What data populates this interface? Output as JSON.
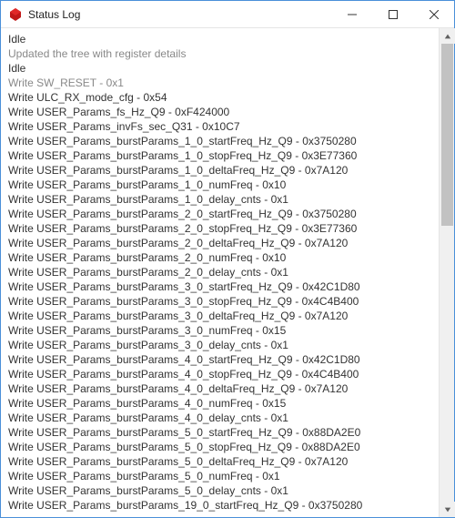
{
  "window": {
    "title": "Status Log"
  },
  "log": {
    "lines": [
      {
        "text": "Idle",
        "grey": false
      },
      {
        "text": "Updated the tree with register details",
        "grey": true
      },
      {
        "text": "Idle",
        "grey": false
      },
      {
        "text": "Write SW_RESET - 0x1",
        "grey": true
      },
      {
        "text": "Write ULC_RX_mode_cfg - 0x54",
        "grey": false
      },
      {
        "text": "Write USER_Params_fs_Hz_Q9 - 0xF424000",
        "grey": false
      },
      {
        "text": "Write USER_Params_invFs_sec_Q31 - 0x10C7",
        "grey": false
      },
      {
        "text": "Write USER_Params_burstParams_1_0_startFreq_Hz_Q9 - 0x3750280",
        "grey": false
      },
      {
        "text": "Write USER_Params_burstParams_1_0_stopFreq_Hz_Q9 - 0x3E77360",
        "grey": false
      },
      {
        "text": "Write USER_Params_burstParams_1_0_deltaFreq_Hz_Q9 - 0x7A120",
        "grey": false
      },
      {
        "text": "Write USER_Params_burstParams_1_0_numFreq - 0x10",
        "grey": false
      },
      {
        "text": "Write USER_Params_burstParams_1_0_delay_cnts - 0x1",
        "grey": false
      },
      {
        "text": "Write USER_Params_burstParams_2_0_startFreq_Hz_Q9 - 0x3750280",
        "grey": false
      },
      {
        "text": "Write USER_Params_burstParams_2_0_stopFreq_Hz_Q9 - 0x3E77360",
        "grey": false
      },
      {
        "text": "Write USER_Params_burstParams_2_0_deltaFreq_Hz_Q9 - 0x7A120",
        "grey": false
      },
      {
        "text": "Write USER_Params_burstParams_2_0_numFreq - 0x10",
        "grey": false
      },
      {
        "text": "Write USER_Params_burstParams_2_0_delay_cnts - 0x1",
        "grey": false
      },
      {
        "text": "Write USER_Params_burstParams_3_0_startFreq_Hz_Q9 - 0x42C1D80",
        "grey": false
      },
      {
        "text": "Write USER_Params_burstParams_3_0_stopFreq_Hz_Q9 - 0x4C4B400",
        "grey": false
      },
      {
        "text": "Write USER_Params_burstParams_3_0_deltaFreq_Hz_Q9 - 0x7A120",
        "grey": false
      },
      {
        "text": "Write USER_Params_burstParams_3_0_numFreq - 0x15",
        "grey": false
      },
      {
        "text": "Write USER_Params_burstParams_3_0_delay_cnts - 0x1",
        "grey": false
      },
      {
        "text": "Write USER_Params_burstParams_4_0_startFreq_Hz_Q9 - 0x42C1D80",
        "grey": false
      },
      {
        "text": "Write USER_Params_burstParams_4_0_stopFreq_Hz_Q9 - 0x4C4B400",
        "grey": false
      },
      {
        "text": "Write USER_Params_burstParams_4_0_deltaFreq_Hz_Q9 - 0x7A120",
        "grey": false
      },
      {
        "text": "Write USER_Params_burstParams_4_0_numFreq - 0x15",
        "grey": false
      },
      {
        "text": "Write USER_Params_burstParams_4_0_delay_cnts - 0x1",
        "grey": false
      },
      {
        "text": "Write USER_Params_burstParams_5_0_startFreq_Hz_Q9 - 0x88DA2E0",
        "grey": false
      },
      {
        "text": "Write USER_Params_burstParams_5_0_stopFreq_Hz_Q9 - 0x88DA2E0",
        "grey": false
      },
      {
        "text": "Write USER_Params_burstParams_5_0_deltaFreq_Hz_Q9 - 0x7A120",
        "grey": false
      },
      {
        "text": "Write USER_Params_burstParams_5_0_numFreq - 0x1",
        "grey": false
      },
      {
        "text": "Write USER_Params_burstParams_5_0_delay_cnts - 0x1",
        "grey": false
      },
      {
        "text": "Write USER_Params_burstParams_19_0_startFreq_Hz_Q9 - 0x3750280",
        "grey": false
      }
    ]
  }
}
